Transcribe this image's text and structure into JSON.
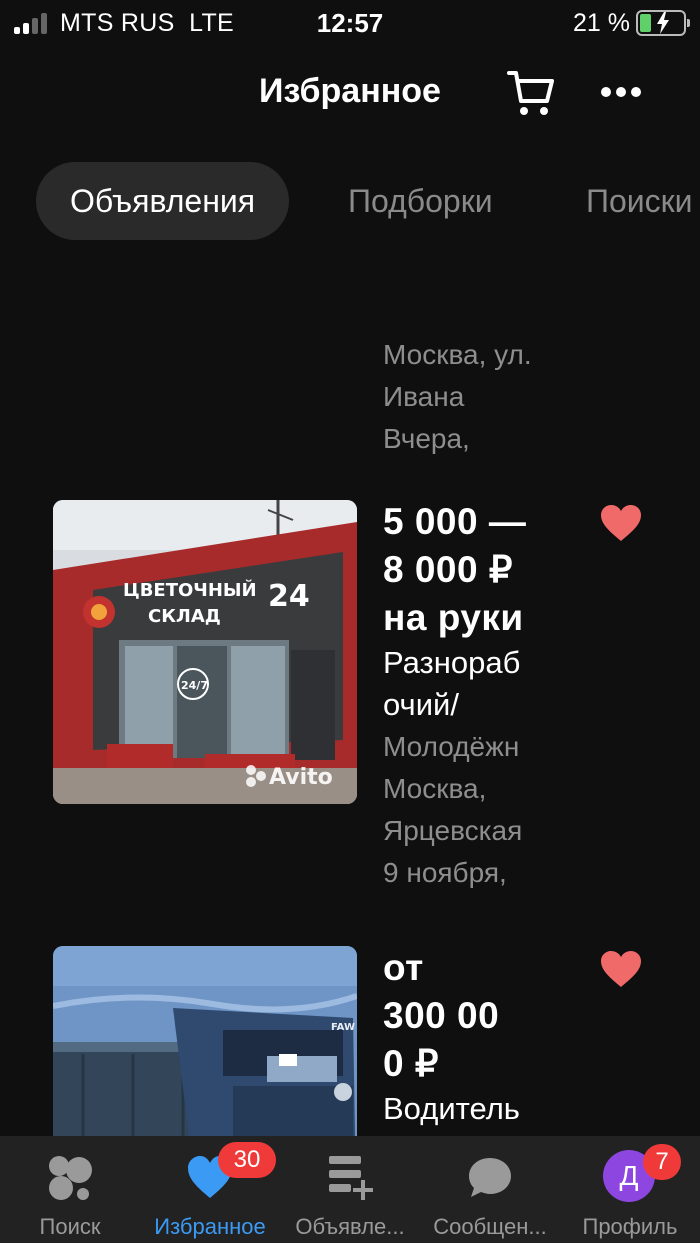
{
  "status_bar": {
    "carrier": "MTS RUS",
    "network": "LTE",
    "time": "12:57",
    "battery_percent": "21 %"
  },
  "header": {
    "title": "Избранное",
    "cart_icon": "cart-icon",
    "more_icon": "more-horizontal-icon"
  },
  "tabs": [
    {
      "label": "Объявления",
      "active": true
    },
    {
      "label": "Подборки",
      "active": false
    },
    {
      "label": "Поиски",
      "active": false
    }
  ],
  "listings": [
    {
      "meta_lines": [
        "Москва, ул.",
        "Ивана",
        "Вчера,"
      ]
    },
    {
      "price": "5 000 —\n8 000 ₽\nна руки",
      "title_lines": [
        "Разнораб",
        "очий/"
      ],
      "meta_lines": [
        "Молодёжн",
        "Москва,",
        "Ярцевская",
        "9 ноября,"
      ],
      "image": {
        "sign_line1": "ЦВЕТОЧНЫЙ",
        "sign_line2": "СКЛАД",
        "sign_number": "24",
        "door_label": "24/7",
        "watermark": "Avito"
      },
      "favorited": true
    },
    {
      "price": "от\n300 00\n0 ₽",
      "title_lines": [
        "Водитель"
      ],
      "image": {
        "truck_brand": "FAW"
      },
      "favorited": true
    }
  ],
  "bottom_nav": [
    {
      "label": "Поиск",
      "icon": "search-dots-icon",
      "active": false
    },
    {
      "label": "Избранное",
      "icon": "heart-icon",
      "active": true,
      "badge": "30"
    },
    {
      "label": "Объявле...",
      "icon": "add-listing-icon",
      "active": false
    },
    {
      "label": "Сообщен...",
      "icon": "chat-bubble-icon",
      "active": false
    },
    {
      "label": "Профиль",
      "icon": "avatar",
      "active": false,
      "badge": "7",
      "avatar_letter": "Д"
    }
  ],
  "colors": {
    "background": "#0f0f0f",
    "accent_blue": "#3b9af4",
    "heart_red": "#f06a6a",
    "badge_red": "#f03a3a",
    "avatar_purple": "#8d47e0"
  }
}
